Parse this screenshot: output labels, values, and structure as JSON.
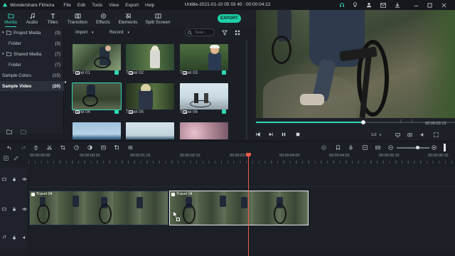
{
  "app": {
    "name": "Wondershare Filmora",
    "window_title": "Untitle-2021-01-10 05 03 45 : 00:00:04:12"
  },
  "menu": [
    "File",
    "Edit",
    "Tools",
    "View",
    "Export",
    "Help"
  ],
  "tabs": [
    {
      "label": "Media",
      "active": true
    },
    {
      "label": "Audio"
    },
    {
      "label": "Titles"
    },
    {
      "label": "Transition"
    },
    {
      "label": "Effects"
    },
    {
      "label": "Elements"
    },
    {
      "label": "Split Screen"
    }
  ],
  "export_label": "EXPORT",
  "sidebar": {
    "items": [
      {
        "label": "Project Media",
        "count": "(3)"
      },
      {
        "label": "Folder",
        "count": "(3)"
      },
      {
        "label": "Shared Media",
        "count": "(7)"
      },
      {
        "label": "Folder",
        "count": "(7)"
      },
      {
        "label": "Sample Colors",
        "count": "(15)"
      },
      {
        "label": "Sample Video",
        "count": "(20)",
        "selected": true
      }
    ]
  },
  "media_toolbar": {
    "import": "Import",
    "record": "Record",
    "search_placeholder": "Sear..."
  },
  "media": [
    {
      "label": "Travel 01"
    },
    {
      "label": "Travel 02"
    },
    {
      "label": "Travel 03"
    },
    {
      "label": "Travel 04",
      "selected": true
    },
    {
      "label": "Travel 05"
    },
    {
      "label": "Travel 06"
    },
    {
      "label": ""
    },
    {
      "label": ""
    },
    {
      "label": ""
    }
  ],
  "player": {
    "timecode": "00:00:03:13",
    "quality": "1/2",
    "progress": 0.54
  },
  "ruler": [
    "00:00:00:00",
    "00:00:00:20",
    "00:00:01:15",
    "00:00:02:10",
    "00:00:03:05",
    "00:00:04:00",
    "00:00:04:20",
    "00:00:05:15",
    "00:00:06:10"
  ],
  "clips": [
    {
      "name": "Travel 04"
    },
    {
      "name": "Travel 04"
    }
  ],
  "colors": {
    "accent": "#2fd6b4",
    "playhead": "#ef5a4a",
    "export": "#1fcfa8"
  }
}
